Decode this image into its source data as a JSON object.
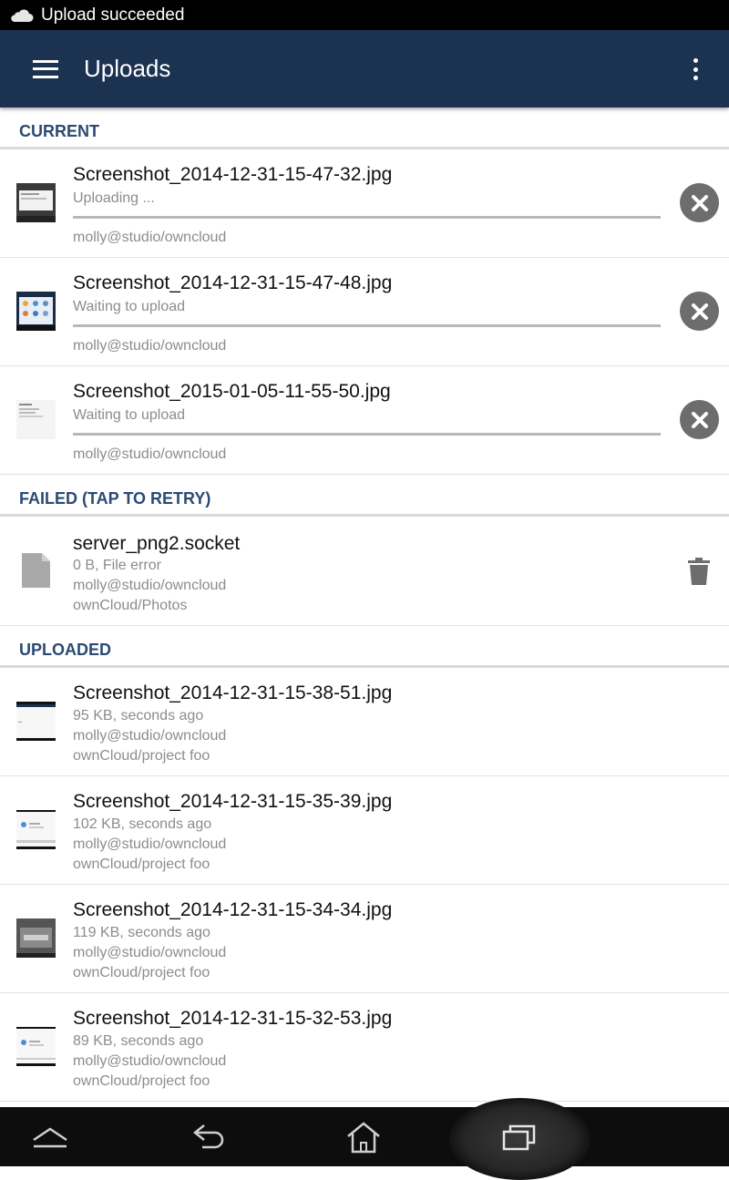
{
  "status_bar": {
    "text": "Upload succeeded",
    "icon": "cloud-icon"
  },
  "app_bar": {
    "title": "Uploads",
    "menu_icon": "hamburger-menu-icon",
    "overflow_icon": "more-vert-icon",
    "color": "#1c3251"
  },
  "sections": {
    "current": {
      "header": "CURRENT",
      "items": [
        {
          "name": "Screenshot_2014-12-31-15-47-32.jpg",
          "status": "Uploading ...",
          "account": "molly@studio/owncloud"
        },
        {
          "name": "Screenshot_2014-12-31-15-47-48.jpg",
          "status": "Waiting to upload",
          "account": "molly@studio/owncloud"
        },
        {
          "name": "Screenshot_2015-01-05-11-55-50.jpg",
          "status": "Waiting to upload",
          "account": "molly@studio/owncloud"
        }
      ]
    },
    "failed": {
      "header": "FAILED (TAP TO RETRY)",
      "items": [
        {
          "name": "server_png2.socket",
          "status": "0 B, File error",
          "account": "molly@studio/owncloud",
          "path": "ownCloud/Photos"
        }
      ]
    },
    "uploaded": {
      "header": "UPLOADED",
      "items": [
        {
          "name": "Screenshot_2014-12-31-15-38-51.jpg",
          "status": "95 KB,  seconds ago",
          "account": "molly@studio/owncloud",
          "path": "ownCloud/project foo"
        },
        {
          "name": "Screenshot_2014-12-31-15-35-39.jpg",
          "status": "102 KB,  seconds ago",
          "account": "molly@studio/owncloud",
          "path": "ownCloud/project foo"
        },
        {
          "name": "Screenshot_2014-12-31-15-34-34.jpg",
          "status": "119 KB,  seconds ago",
          "account": "molly@studio/owncloud",
          "path": "ownCloud/project foo"
        },
        {
          "name": "Screenshot_2014-12-31-15-32-53.jpg",
          "status": "89 KB,  seconds ago",
          "account": "molly@studio/owncloud",
          "path": "ownCloud/project foo"
        }
      ]
    }
  },
  "nav_bar": {
    "icons": [
      "nav-up-icon",
      "back-icon",
      "home-icon",
      "recent-apps-icon"
    ]
  },
  "colors": {
    "section_header": "#2b4a73",
    "secondary_text": "#8c8c8c",
    "cancel_button": "#6d6d6d"
  }
}
